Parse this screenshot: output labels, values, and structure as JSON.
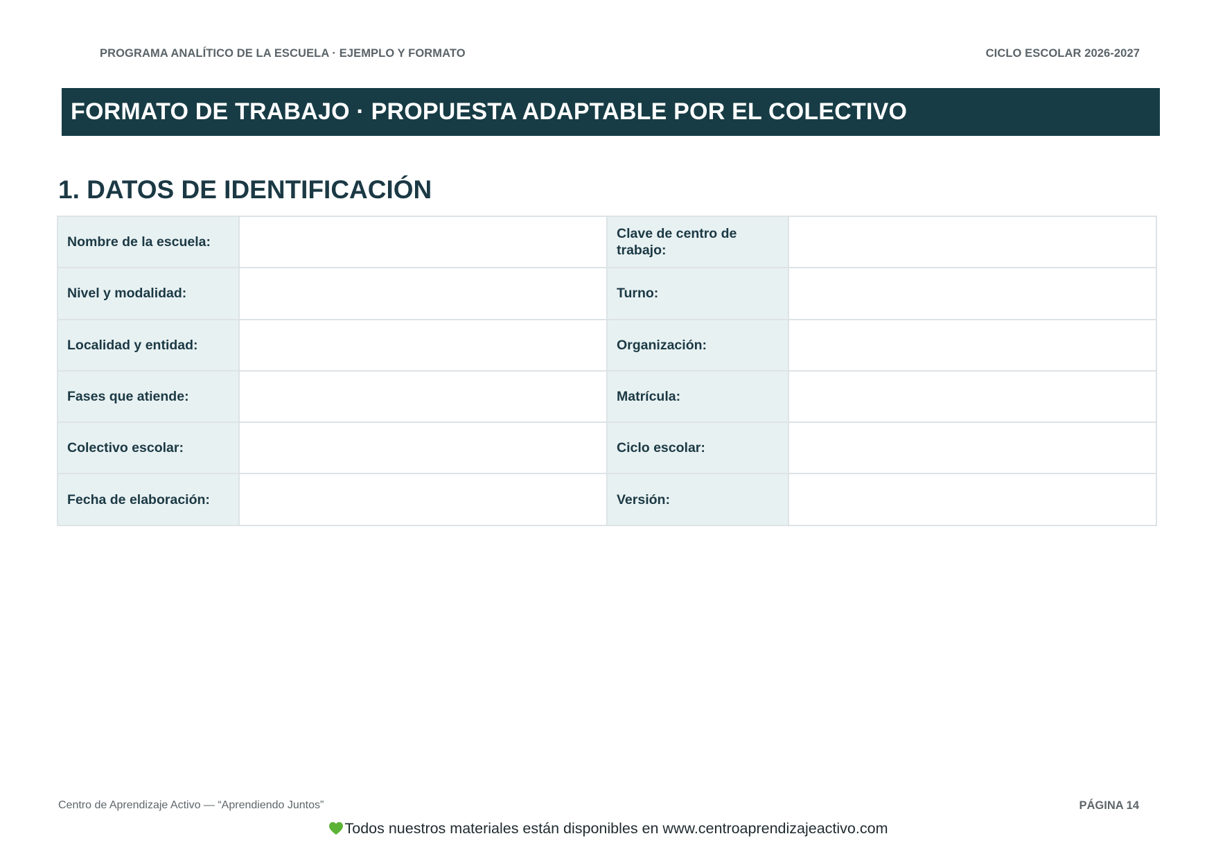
{
  "header": {
    "left": "PROGRAMA ANALÍTICO DE LA ESCUELA · EJEMPLO Y FORMATO",
    "right": "CICLO ESCOLAR 2026-2027"
  },
  "banner": {
    "title": "FORMATO DE TRABAJO · PROPUESTA ADAPTABLE POR EL COLECTIVO"
  },
  "section": {
    "title": "1. DATOS DE IDENTIFICACIÓN"
  },
  "identification_table": {
    "rows": [
      {
        "left_label": "Nombre de la escuela:",
        "left_value": "",
        "right_label": "Clave de centro de trabajo:",
        "right_value": ""
      },
      {
        "left_label": "Nivel y modalidad:",
        "left_value": "",
        "right_label": "Turno:",
        "right_value": ""
      },
      {
        "left_label": "Localidad y entidad:",
        "left_value": "",
        "right_label": "Organización:",
        "right_value": ""
      },
      {
        "left_label": "Fases que atiende:",
        "left_value": "",
        "right_label": "Matrícula:",
        "right_value": ""
      },
      {
        "left_label": "Colectivo escolar:",
        "left_value": "",
        "right_label": "Ciclo escolar:",
        "right_value": ""
      },
      {
        "left_label": "Fecha de elaboración:",
        "left_value": "",
        "right_label": "Versión:",
        "right_value": ""
      }
    ]
  },
  "footer": {
    "left": "Centro de Aprendizaje Activo — “Aprendiendo Juntos”",
    "right": "PÁGINA 14",
    "note": "Todos nuestros materiales están disponibles en www.centroaprendizajeactivo.com",
    "note_icon": "green-heart-icon"
  },
  "colors": {
    "banner_bg": "#173c45",
    "label_bg": "#e8f1f2",
    "heading_text": "#1b3944",
    "heart": "#5bb335"
  }
}
